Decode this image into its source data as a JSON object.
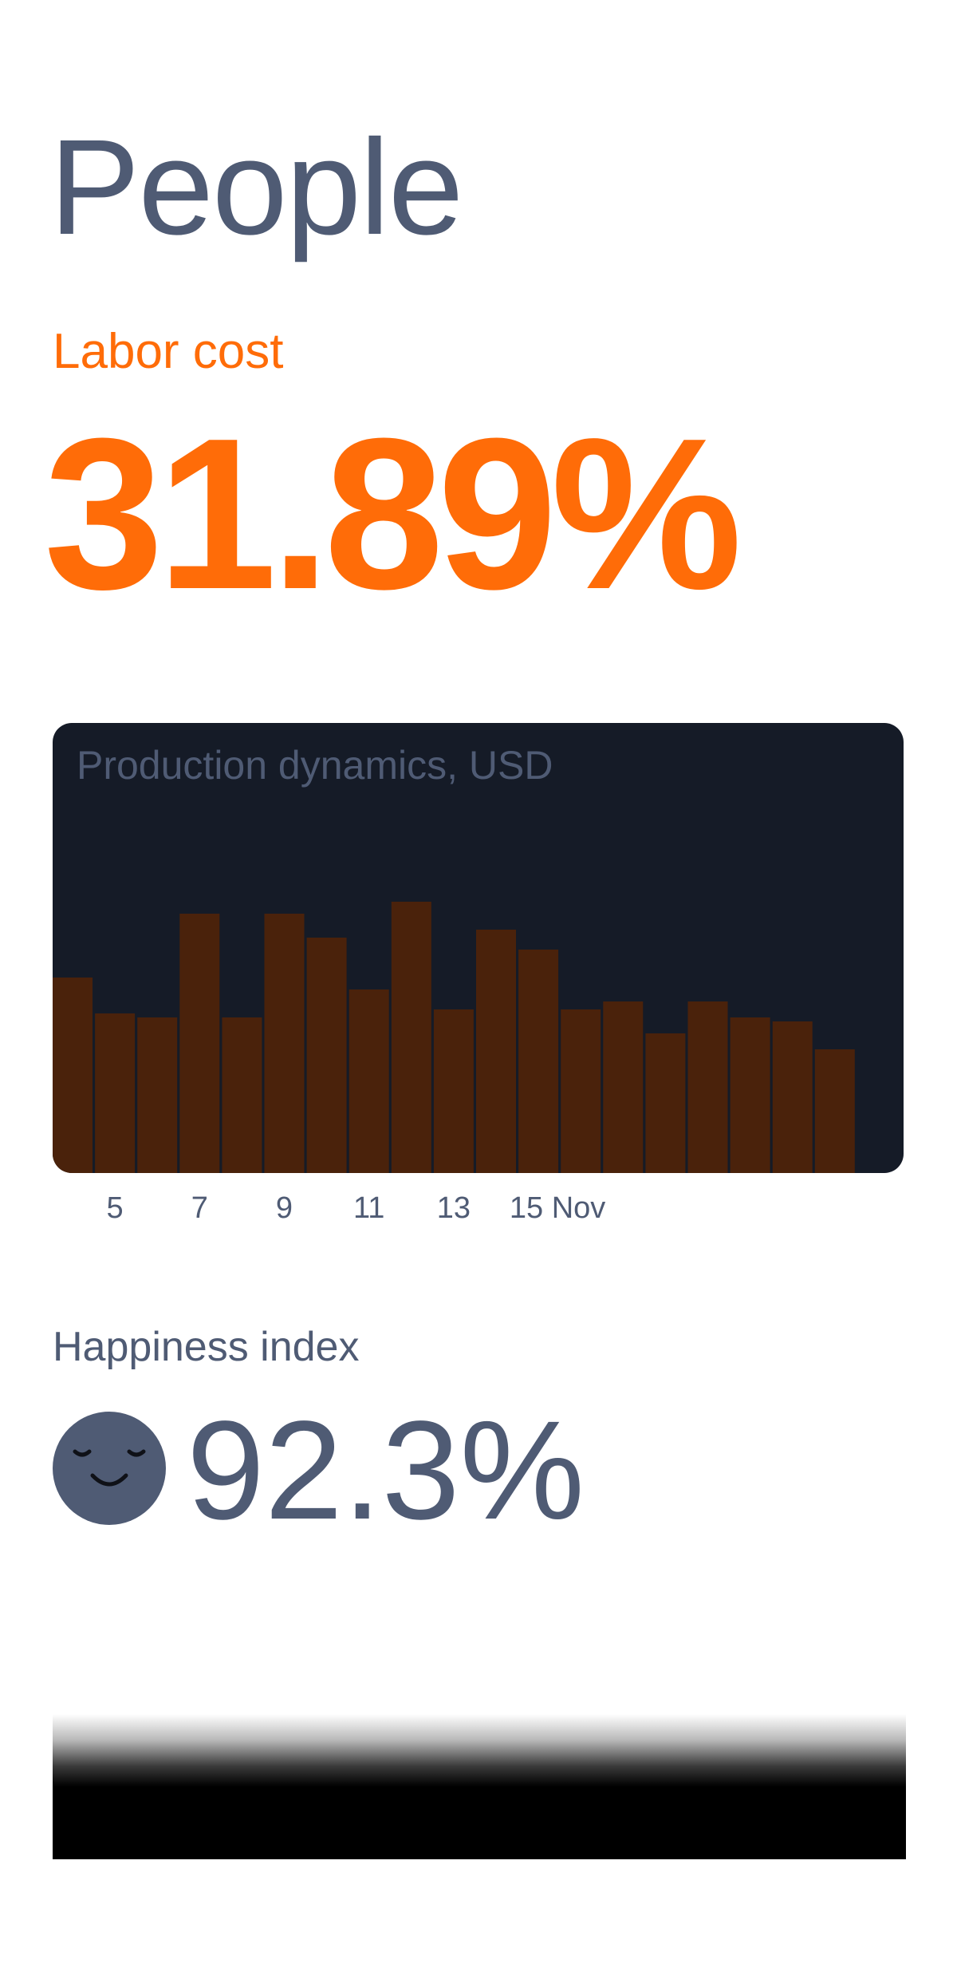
{
  "page": {
    "title": "People"
  },
  "labor_cost": {
    "label": "Labor cost",
    "value": "31.89%"
  },
  "chart_data": {
    "type": "bar",
    "title": "Production dynamics, USD",
    "categories": [
      "4",
      "5",
      "6",
      "7",
      "8",
      "9",
      "10",
      "11",
      "12",
      "13",
      "14",
      "15",
      "16",
      "17",
      "18",
      "19",
      "20",
      "21",
      "22"
    ],
    "values": [
      49,
      40,
      39,
      65,
      39,
      65,
      59,
      46,
      68,
      41,
      61,
      56,
      41,
      43,
      35,
      43,
      39,
      38,
      31
    ],
    "tick_labels": [
      "5",
      "7",
      "9",
      "11",
      "13",
      "15 Nov"
    ],
    "ylim": [
      0,
      100
    ],
    "bar_color": "#4a220b",
    "background": "#151b27",
    "grid": false,
    "xlabel": "",
    "ylabel": ""
  },
  "happiness": {
    "label": "Happiness index",
    "value": "92.3%",
    "icon": "smiling-face-icon"
  },
  "colors": {
    "accent": "#ff6c08",
    "text": "#4f5b74",
    "card": "#151b27"
  }
}
